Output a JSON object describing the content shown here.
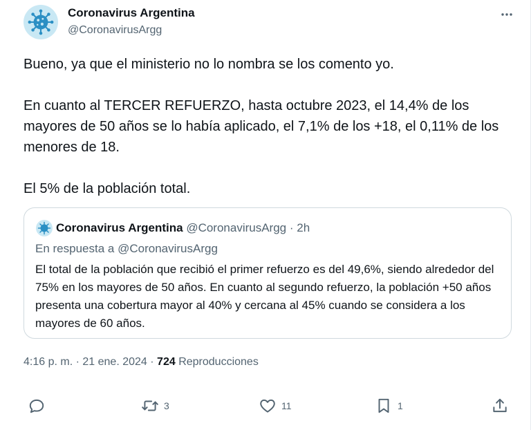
{
  "author": {
    "name": "Coronavirus Argentina",
    "handle": "@CoronavirusArgg"
  },
  "tweet": {
    "paragraphs": [
      "Bueno, ya que el ministerio no lo nombra se los comento yo.",
      "En cuanto al TERCER REFUERZO, hasta octubre 2023, el 14,4% de los mayores de 50 años se lo había aplicado, el 7,1% de los +18, el 0,11% de los menores de 18.",
      "El 5% de la población total."
    ]
  },
  "quoted": {
    "name": "Coronavirus Argentina",
    "handle": "@CoronavirusArgg",
    "separator": "·",
    "time": "2h",
    "reply_prefix": "En respuesta a",
    "reply_handle": "@CoronavirusArgg",
    "text": "El total de la población que recibió el primer refuerzo es del 49,6%, siendo alrededor del 75% en los mayores de 50 años. En cuanto al segundo refuerzo, la población +50 años presenta una cobertura mayor al 40% y cercana al 45% cuando se considera a los mayores de 60 años."
  },
  "meta": {
    "time": "4:16 p. m.",
    "separator": "·",
    "date": "21 ene. 2024",
    "views": "724",
    "views_label": "Reproducciones"
  },
  "actions": {
    "replies": "",
    "retweets": "3",
    "likes": "11",
    "bookmarks": "1"
  },
  "colors": {
    "text": "#0f1419",
    "secondary": "#536471",
    "border": "#cfd9de",
    "avatar_bg": "#c9e8f4",
    "virus": "#2a8fc4"
  },
  "icons": {
    "avatar": "virus-icon",
    "more": "more-dots-icon",
    "reply": "reply-icon",
    "retweet": "retweet-icon",
    "like": "heart-icon",
    "bookmark": "bookmark-icon",
    "share": "share-icon"
  }
}
